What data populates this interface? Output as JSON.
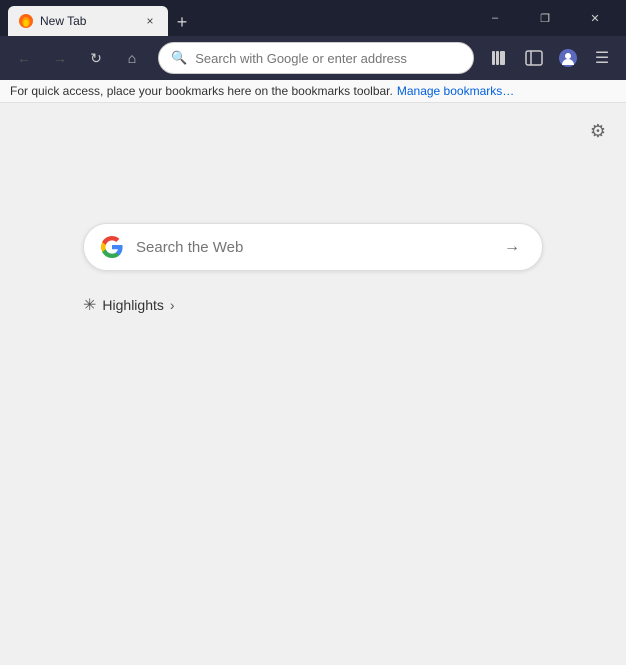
{
  "titlebar": {
    "tab": {
      "label": "New Tab",
      "close": "×"
    },
    "new_tab_btn": "+",
    "window_controls": {
      "minimize": "–",
      "maximize": "❐",
      "close": "✕"
    }
  },
  "navbar": {
    "back_btn": "←",
    "forward_btn": "→",
    "reload_btn": "↻",
    "home_btn": "⌂",
    "address_placeholder": "Search with Google or enter address",
    "library_icon": "📚",
    "sidebar_icon": "▣",
    "account_icon": "👤",
    "menu_icon": "☰"
  },
  "bookmarks_bar": {
    "message": "For quick access, place your bookmarks here on the bookmarks toolbar.",
    "manage_link": "Manage bookmarks…"
  },
  "page": {
    "gear_icon": "⚙",
    "search_placeholder": "Search the Web",
    "search_arrow": "→",
    "highlights": {
      "label": "Highlights",
      "chevron": "›"
    }
  }
}
